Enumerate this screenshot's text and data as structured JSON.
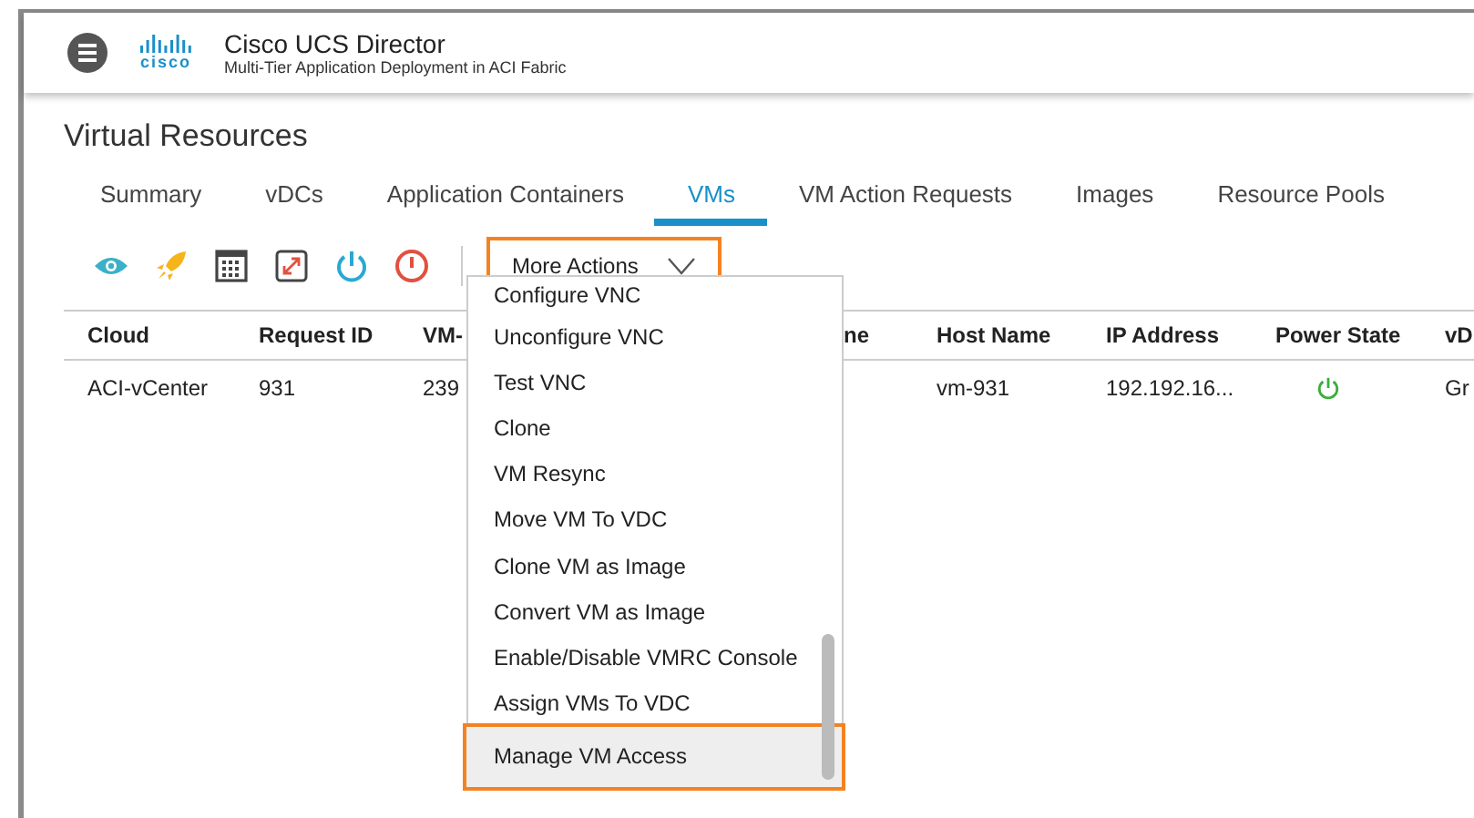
{
  "header": {
    "logo": "cisco",
    "title": "Cisco UCS Director",
    "subtitle": "Multi-Tier Application Deployment in ACI Fabric"
  },
  "page_title": "Virtual Resources",
  "tabs": [
    {
      "label": "Summary",
      "selected": false
    },
    {
      "label": "vDCs",
      "selected": false
    },
    {
      "label": "Application Containers",
      "selected": false
    },
    {
      "label": "VMs",
      "selected": true
    },
    {
      "label": "VM Action Requests",
      "selected": false
    },
    {
      "label": "Images",
      "selected": false
    },
    {
      "label": "Resource Pools",
      "selected": false
    }
  ],
  "toolbar": {
    "icons": [
      {
        "kind": "view"
      },
      {
        "kind": "launch"
      },
      {
        "kind": "calendar"
      },
      {
        "kind": "resize"
      },
      {
        "kind": "power-on"
      },
      {
        "kind": "power-off"
      }
    ],
    "more_actions": {
      "label": "More Actions",
      "expanded": true
    }
  },
  "table": {
    "columns": [
      "Cloud",
      "Request ID",
      "VM-",
      "ne",
      "Host Name",
      "IP Address",
      "Power State",
      "vD"
    ],
    "rows": [
      {
        "cells": [
          "ACI-vCenter",
          "931",
          "239",
          "",
          "vm-931",
          "192.192.16...",
          {
            "kind": "power",
            "on": true
          },
          "Gr"
        ]
      }
    ]
  },
  "menu": {
    "items": [
      {
        "label": "Configure VNC",
        "selected": false
      },
      {
        "label": "Unconfigure VNC",
        "selected": false
      },
      {
        "label": "Test VNC",
        "selected": false
      },
      {
        "label": "Clone",
        "selected": false
      },
      {
        "label": "VM Resync",
        "selected": false
      },
      {
        "label": "Move VM To VDC",
        "selected": false
      },
      {
        "label": "Clone VM as Image",
        "selected": false
      },
      {
        "label": "Convert VM as Image",
        "selected": false
      },
      {
        "label": "Enable/Disable VMRC Console",
        "selected": false
      },
      {
        "label": "Assign VMs To VDC",
        "selected": false
      },
      {
        "label": "Manage VM Access",
        "selected": true
      }
    ]
  }
}
